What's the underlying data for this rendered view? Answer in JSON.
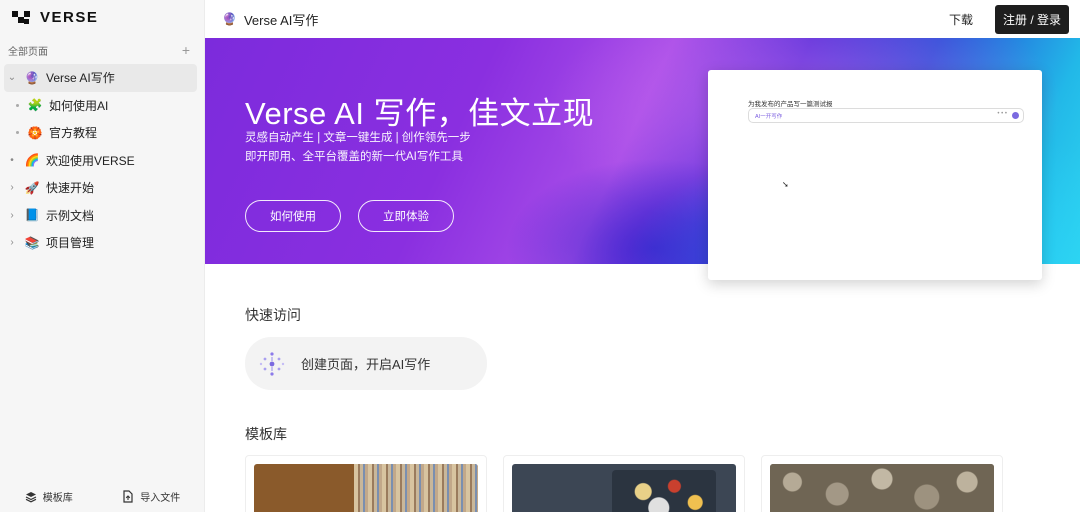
{
  "sidebar": {
    "logo_text": "VERSE",
    "all_pages_label": "全部页面",
    "add_icon": "plus-icon",
    "items": [
      {
        "label": "Verse AI写作",
        "icon": "🔮",
        "level": 0,
        "caret": "⌄",
        "active": true
      },
      {
        "label": "如何使用AI",
        "icon": "🧩",
        "level": 1
      },
      {
        "label": "官方教程",
        "icon": "🏵️",
        "level": 1
      },
      {
        "label": "欢迎使用VERSE",
        "icon": "🌈",
        "level": 0,
        "caret": "•"
      },
      {
        "label": "快速开始",
        "icon": "🚀",
        "level": 0,
        "caret": "›"
      },
      {
        "label": "示例文档",
        "icon": "📘",
        "level": 0,
        "caret": "›"
      },
      {
        "label": "项目管理",
        "icon": "📚",
        "level": 0,
        "caret": "›"
      }
    ],
    "footer": {
      "templates_label": "模板库",
      "import_label": "导入文件"
    }
  },
  "topbar": {
    "page_title": "Verse AI写作",
    "download_label": "下载",
    "login_label": "注册 / 登录"
  },
  "banner": {
    "title": "Verse AI 写作，佳文立现",
    "subtitle1": "灵感自动产生 | 文章一键生成 | 创作领先一步",
    "subtitle2": "即开即用、全平台覆盖的新一代AI写作工具",
    "btn_how": "如何使用",
    "btn_try": "立即体验",
    "preview_title": "为我发布的产品写一篇测试报",
    "preview_input": "AI一开写作",
    "preview_dots": "• • •"
  },
  "quick_access": {
    "title": "快速访问",
    "item_label": "创建页面，开启AI写作"
  },
  "templates": {
    "title": "模板库"
  },
  "colors": {
    "accent_purple": "#7b6ae0",
    "login_bg": "#1e1e1e",
    "sidebar_bg": "#f6f6f6"
  }
}
